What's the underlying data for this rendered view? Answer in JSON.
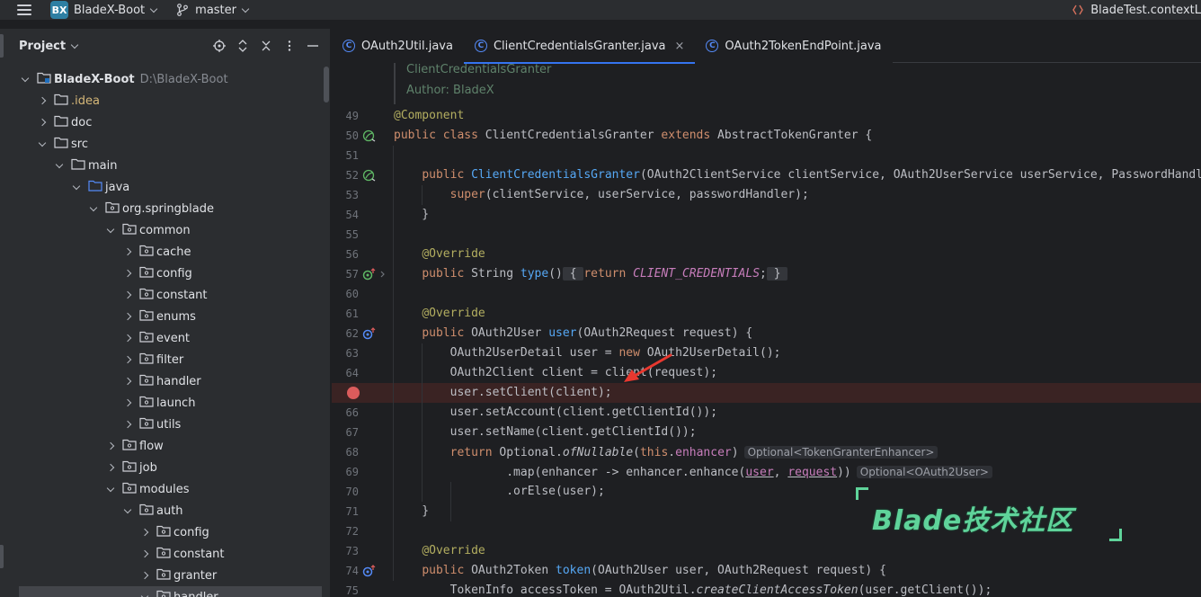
{
  "topbar": {
    "logo_text": "BX",
    "project": "BladeX-Boot",
    "branch": "master",
    "run_config": "BladeTest.contextL"
  },
  "panel": {
    "title": "Project"
  },
  "tree": [
    {
      "label": "BladeX-Boot",
      "path": "D:\\BladeX-Boot",
      "depth": 0,
      "state": "open",
      "kind": "module"
    },
    {
      "label": ".idea",
      "depth": 1,
      "state": "closed",
      "kind": "folder"
    },
    {
      "label": "doc",
      "depth": 1,
      "state": "closed",
      "kind": "folder"
    },
    {
      "label": "src",
      "depth": 1,
      "state": "open",
      "kind": "folder"
    },
    {
      "label": "main",
      "depth": 2,
      "state": "open",
      "kind": "folder"
    },
    {
      "label": "java",
      "depth": 3,
      "state": "open",
      "kind": "source"
    },
    {
      "label": "org.springblade",
      "depth": 4,
      "state": "open",
      "kind": "package"
    },
    {
      "label": "common",
      "depth": 5,
      "state": "open",
      "kind": "package"
    },
    {
      "label": "cache",
      "depth": 6,
      "state": "closed",
      "kind": "package"
    },
    {
      "label": "config",
      "depth": 6,
      "state": "closed",
      "kind": "package"
    },
    {
      "label": "constant",
      "depth": 6,
      "state": "closed",
      "kind": "package"
    },
    {
      "label": "enums",
      "depth": 6,
      "state": "closed",
      "kind": "package"
    },
    {
      "label": "event",
      "depth": 6,
      "state": "closed",
      "kind": "package"
    },
    {
      "label": "filter",
      "depth": 6,
      "state": "closed",
      "kind": "package"
    },
    {
      "label": "handler",
      "depth": 6,
      "state": "closed",
      "kind": "package"
    },
    {
      "label": "launch",
      "depth": 6,
      "state": "closed",
      "kind": "package"
    },
    {
      "label": "utils",
      "depth": 6,
      "state": "closed",
      "kind": "package"
    },
    {
      "label": "flow",
      "depth": 5,
      "state": "closed",
      "kind": "package"
    },
    {
      "label": "job",
      "depth": 5,
      "state": "closed",
      "kind": "package"
    },
    {
      "label": "modules",
      "depth": 5,
      "state": "open",
      "kind": "package"
    },
    {
      "label": "auth",
      "depth": 6,
      "state": "open",
      "kind": "package"
    },
    {
      "label": "config",
      "depth": 7,
      "state": "closed",
      "kind": "package"
    },
    {
      "label": "constant",
      "depth": 7,
      "state": "closed",
      "kind": "package"
    },
    {
      "label": "granter",
      "depth": 7,
      "state": "closed",
      "kind": "package"
    },
    {
      "label": "handler",
      "depth": 7,
      "state": "open",
      "kind": "package",
      "selected": true
    }
  ],
  "tabs": [
    {
      "label": "OAuth2Util.java",
      "active": false
    },
    {
      "label": "ClientCredentialsGranter.java",
      "active": true,
      "close": "×"
    },
    {
      "label": "OAuth2TokenEndPoint.java",
      "active": false
    }
  ],
  "doc_comment": [
    "ClientCredentialsGranter",
    "Author: BladeX"
  ],
  "code_lines": [
    {
      "n": "49",
      "html": "<span class=\"an\">@Component</span>"
    },
    {
      "n": "50",
      "icon": "bean",
      "html": "<span class=\"kw\">public class </span>ClientCredentialsGranter <span class=\"kw\">extends </span>AbstractTokenGranter {"
    },
    {
      "n": "51",
      "html": ""
    },
    {
      "n": "52",
      "icon": "bean",
      "html": "    <span class=\"kw\">public </span><span class=\"fn\">ClientCredentialsGranter</span>(OAuth2ClientService clientService, OAuth2UserService userService, PasswordHandler"
    },
    {
      "n": "53",
      "html": "        <span class=\"kw\">super</span>(clientService, userService, passwordHandler);"
    },
    {
      "n": "54",
      "html": "    }"
    },
    {
      "n": "55",
      "html": ""
    },
    {
      "n": "56",
      "html": "    <span class=\"an\">@Override</span>"
    },
    {
      "n": "57",
      "icon": "override-fold",
      "html": "    <span class=\"kw\">public </span>String <span class=\"fn\">type</span>()<span class=\"fold\"> { </span><span class=\"kw\">return </span><span class=\"cst\">CLIENT_CREDENTIALS</span>;<span class=\"fold\"> } </span>"
    },
    {
      "n": "60",
      "html": ""
    },
    {
      "n": "61",
      "html": "    <span class=\"an\">@Override</span>"
    },
    {
      "n": "62",
      "icon": "override",
      "html": "    <span class=\"kw\">public </span>OAuth2User <span class=\"fn\">user</span>(OAuth2Request request) {"
    },
    {
      "n": "63",
      "html": "        OAuth2UserDetail user = <span class=\"kw\">new </span>OAuth2UserDetail();"
    },
    {
      "n": "64",
      "html": "        OAuth2Client client = client(request);"
    },
    {
      "n": "",
      "bp": true,
      "html": "        user.setClient(client);"
    },
    {
      "n": "66",
      "html": "        user.setAccount(client.getClientId());"
    },
    {
      "n": "67",
      "html": "        user.setName(client.getClientId());"
    },
    {
      "n": "68",
      "html": "        <span class=\"kw\">return </span>Optional.<span class=\"it\">ofNullable</span>(<span class=\"kw\">this</span>.<span class=\"cst\" style=\"font-style:normal\">enhancer</span>)<span class=\"hint\">Optional&lt;TokenGranterEnhancer&gt;</span>"
    },
    {
      "n": "69",
      "html": "                .map(enhancer -&gt; enhancer.enhance(<span class=\"ul\" style=\"color:#c77dbb\">user</span>, <span class=\"ul\" style=\"color:#c77dbb\">request</span>))<span class=\"hint\">Optional&lt;OAuth2User&gt;</span>"
    },
    {
      "n": "70",
      "html": "                .orElse(user);"
    },
    {
      "n": "71",
      "html": "    }"
    },
    {
      "n": "72",
      "html": ""
    },
    {
      "n": "73",
      "html": "    <span class=\"an\">@Override</span>"
    },
    {
      "n": "74",
      "icon": "override",
      "html": "    <span class=\"kw\">public </span>OAuth2Token <span class=\"fn\">token</span>(OAuth2User user, OAuth2Request request) {"
    },
    {
      "n": "75",
      "html": "        TokenInfo accessToken = OAuth2Util.<span class=\"it\">createClientAccessToken</span>(user.getClient());"
    }
  ],
  "watermark": "Blade技术社区",
  "colors": {
    "accent": "#3574f0",
    "breakpoint": "#db5c5c",
    "annotation_arrow": "#e8382f",
    "watermark": "#5fd39a"
  }
}
